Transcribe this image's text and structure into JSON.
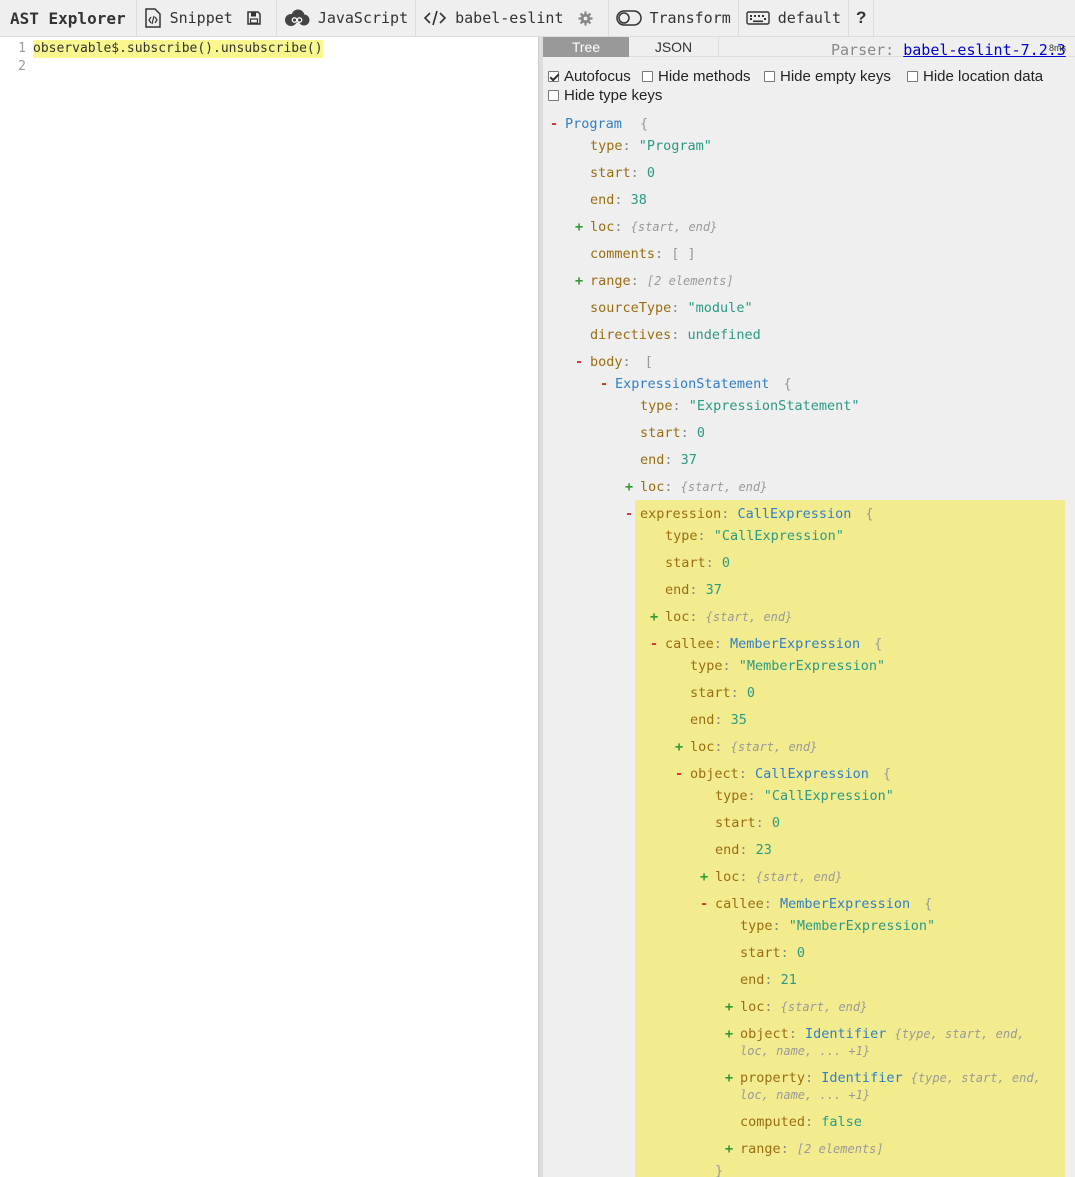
{
  "app": {
    "title": "AST Explorer"
  },
  "toolbar": {
    "snippet": "Snippet",
    "language": "JavaScript",
    "parser": "babel-eslint",
    "transform": "Transform",
    "keymap": "default",
    "help": "?"
  },
  "editor": {
    "lines": [
      {
        "num": "1",
        "text": "observable$.subscribe().unsubscribe()"
      },
      {
        "num": "2",
        "text": ""
      }
    ]
  },
  "output": {
    "tabs": [
      "Tree",
      "JSON"
    ],
    "active_tab": "Tree",
    "parser_label": "Parser:",
    "parser_link": "babel-eslint-7.2.3",
    "parse_time": "8ms",
    "options": {
      "autofocus": "Autofocus",
      "autofocus_checked": true,
      "hide_methods": "Hide methods",
      "hide_empty_keys": "Hide empty keys",
      "hide_location_data": "Hide location data",
      "hide_type_keys": "Hide type keys"
    }
  },
  "tree": {
    "program": {
      "label": "Program",
      "brace": "{"
    },
    "p_type": {
      "key": "type",
      "value": "\"Program\""
    },
    "p_start": {
      "key": "start",
      "value": "0"
    },
    "p_end": {
      "key": "end",
      "value": "38"
    },
    "p_loc": {
      "key": "loc",
      "summary": "{start, end}"
    },
    "p_comments": {
      "key": "comments",
      "value": "[ ]"
    },
    "p_range": {
      "key": "range",
      "summary": "[2 elements]"
    },
    "p_sourceType": {
      "key": "sourceType",
      "value": "\"module\""
    },
    "p_directives": {
      "key": "directives",
      "value": "undefined"
    },
    "p_body": {
      "key": "body",
      "brace": "["
    },
    "es": {
      "label": "ExpressionStatement",
      "brace": "{"
    },
    "es_type": {
      "key": "type",
      "value": "\"ExpressionStatement\""
    },
    "es_start": {
      "key": "start",
      "value": "0"
    },
    "es_end": {
      "key": "end",
      "value": "37"
    },
    "es_loc": {
      "key": "loc",
      "summary": "{start, end}"
    },
    "expr": {
      "key": "expression",
      "type": "CallExpression",
      "brace": "{"
    },
    "ex_type": {
      "key": "type",
      "value": "\"CallExpression\""
    },
    "ex_start": {
      "key": "start",
      "value": "0"
    },
    "ex_end": {
      "key": "end",
      "value": "37"
    },
    "ex_loc": {
      "key": "loc",
      "summary": "{start, end}"
    },
    "callee1": {
      "key": "callee",
      "type": "MemberExpression",
      "brace": "{"
    },
    "c1_type": {
      "key": "type",
      "value": "\"MemberExpression\""
    },
    "c1_start": {
      "key": "start",
      "value": "0"
    },
    "c1_end": {
      "key": "end",
      "value": "35"
    },
    "c1_loc": {
      "key": "loc",
      "summary": "{start, end}"
    },
    "obj1": {
      "key": "object",
      "type": "CallExpression",
      "brace": "{"
    },
    "o1_type": {
      "key": "type",
      "value": "\"CallExpression\""
    },
    "o1_start": {
      "key": "start",
      "value": "0"
    },
    "o1_end": {
      "key": "end",
      "value": "23"
    },
    "o1_loc": {
      "key": "loc",
      "summary": "{start, end}"
    },
    "callee2": {
      "key": "callee",
      "type": "MemberExpression",
      "brace": "{"
    },
    "c2_type": {
      "key": "type",
      "value": "\"MemberExpression\""
    },
    "c2_start": {
      "key": "start",
      "value": "0"
    },
    "c2_end": {
      "key": "end",
      "value": "21"
    },
    "c2_loc": {
      "key": "loc",
      "summary": "{start, end}"
    },
    "c2_object": {
      "key": "object",
      "type": "Identifier",
      "summary1": "{type, start, end,",
      "summary2": "loc, name, ... +1}"
    },
    "c2_property": {
      "key": "property",
      "type": "Identifier",
      "summary1": "{type, start, end,",
      "summary2": "loc, name, ... +1}"
    },
    "c2_computed": {
      "key": "computed",
      "value": "false"
    },
    "c2_range": {
      "key": "range",
      "summary": "[2 elements]"
    },
    "close": "}"
  },
  "colors": {
    "highlight": "#f3ec8e",
    "key": "#9a6d11",
    "type_name": "#2f7fc7",
    "string": "#2a9a85",
    "toggle_minus": "#c33",
    "toggle_plus": "#393"
  }
}
